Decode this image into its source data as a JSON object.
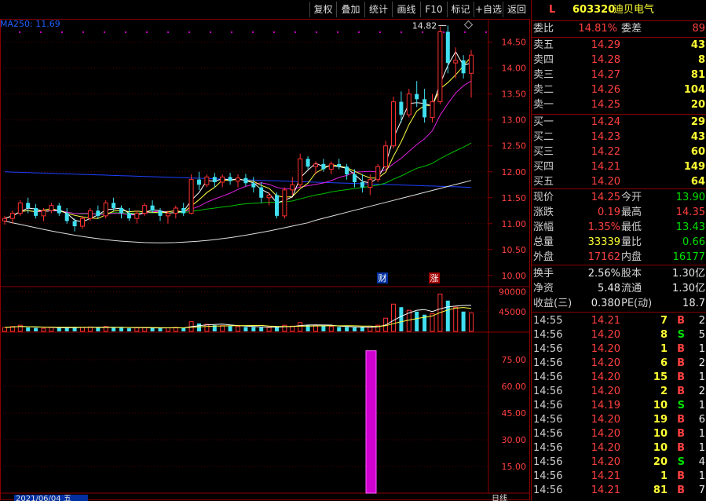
{
  "toolbar": {
    "buttons": [
      "复权",
      "叠加",
      "统计",
      "画线",
      "F10",
      "标记",
      "+自选",
      "返回"
    ]
  },
  "chart": {
    "ma_label": "MA250: 11.69",
    "high_marker": "14.82",
    "price_ticks": [
      "14.50",
      "14.00",
      "13.50",
      "13.00",
      "12.50",
      "12.00",
      "11.50",
      "11.00",
      "10.50",
      "10.00"
    ],
    "volume_ticks": [
      "90000",
      "45000"
    ],
    "indicator_ticks": [
      "75.00",
      "60.00",
      "45.00",
      "30.00",
      "15.00"
    ],
    "tag_cai": "财",
    "tag_zhang": "涨",
    "date_label": "2021/06/04 五",
    "corner_label": "日线"
  },
  "quote": {
    "market": "L",
    "code": "603320",
    "name": "迪贝电气",
    "weibi_label": "委比",
    "weibi": "14.81%",
    "weicha_label": "委差",
    "weicha": "89",
    "asks": [
      {
        "label": "卖五",
        "price": "14.29",
        "vol": "43"
      },
      {
        "label": "卖四",
        "price": "14.28",
        "vol": "8"
      },
      {
        "label": "卖三",
        "price": "14.27",
        "vol": "81"
      },
      {
        "label": "卖二",
        "price": "14.26",
        "vol": "104"
      },
      {
        "label": "卖一",
        "price": "14.25",
        "vol": "20"
      }
    ],
    "bids": [
      {
        "label": "买一",
        "price": "14.24",
        "vol": "29"
      },
      {
        "label": "买二",
        "price": "14.23",
        "vol": "43"
      },
      {
        "label": "买三",
        "price": "14.22",
        "vol": "60"
      },
      {
        "label": "买四",
        "price": "14.21",
        "vol": "149"
      },
      {
        "label": "买五",
        "price": "14.20",
        "vol": "64"
      }
    ],
    "stats": [
      {
        "l1": "现价",
        "v1": "14.25",
        "c1": "red",
        "l2": "今开",
        "v2": "13.90",
        "c2": "green"
      },
      {
        "l1": "涨跌",
        "v1": "0.19",
        "c1": "red",
        "l2": "最高",
        "v2": "14.35",
        "c2": "red"
      },
      {
        "l1": "涨幅",
        "v1": "1.35%",
        "c1": "red",
        "l2": "最低",
        "v2": "13.43",
        "c2": "green"
      },
      {
        "l1": "总量",
        "v1": "33339",
        "c1": "yellow",
        "l2": "量比",
        "v2": "0.66",
        "c2": "green"
      },
      {
        "l1": "外盘",
        "v1": "17162",
        "c1": "red",
        "l2": "内盘",
        "v2": "16177",
        "c2": "green"
      }
    ],
    "stats2": [
      {
        "l1": "换手",
        "v1": "2.56%",
        "l2": "股本",
        "v2": "1.30亿"
      },
      {
        "l1": "净资",
        "v1": "5.48",
        "l2": "流通",
        "v2": "1.30亿"
      },
      {
        "l1": "收益(三)",
        "v1": "0.380",
        "l2": "PE(动)",
        "v2": "18.7"
      }
    ],
    "ticks": [
      {
        "time": "14:55",
        "price": "14.21",
        "vol": "7",
        "side": "B",
        "n": "2"
      },
      {
        "time": "14:56",
        "price": "14.20",
        "vol": "8",
        "side": "S",
        "n": "5"
      },
      {
        "time": "14:56",
        "price": "14.20",
        "vol": "1",
        "side": "B",
        "n": "1"
      },
      {
        "time": "14:56",
        "price": "14.20",
        "vol": "6",
        "side": "B",
        "n": "2"
      },
      {
        "time": "14:56",
        "price": "14.20",
        "vol": "15",
        "side": "B",
        "n": "1"
      },
      {
        "time": "14:56",
        "price": "14.20",
        "vol": "2",
        "side": "B",
        "n": "2"
      },
      {
        "time": "14:56",
        "price": "14.19",
        "vol": "10",
        "side": "S",
        "n": "1"
      },
      {
        "time": "14:56",
        "price": "14.20",
        "vol": "19",
        "side": "B",
        "n": "6"
      },
      {
        "time": "14:56",
        "price": "14.20",
        "vol": "10",
        "side": "B",
        "n": "1"
      },
      {
        "time": "14:56",
        "price": "14.20",
        "vol": "10",
        "side": "B",
        "n": "1"
      },
      {
        "time": "14:56",
        "price": "14.20",
        "vol": "20",
        "side": "S",
        "n": "4"
      },
      {
        "time": "14:56",
        "price": "14.21",
        "vol": "1",
        "side": "B",
        "n": "1"
      },
      {
        "time": "14:56",
        "price": "14.21",
        "vol": "81",
        "side": "B",
        "n": "7"
      }
    ]
  },
  "chart_data": {
    "type": "candlestick",
    "price_range": [
      9.8,
      14.95
    ],
    "volume_range": [
      0,
      100000
    ],
    "indicator_range": [
      0,
      90
    ],
    "candles": [
      [
        11.05,
        11.15,
        10.98,
        11.1
      ],
      [
        11.1,
        11.25,
        11.0,
        11.2
      ],
      [
        11.2,
        11.45,
        11.15,
        11.4
      ],
      [
        11.4,
        11.5,
        11.2,
        11.3
      ],
      [
        11.3,
        11.38,
        11.1,
        11.15
      ],
      [
        11.15,
        11.3,
        11.05,
        11.25
      ],
      [
        11.25,
        11.4,
        11.2,
        11.35
      ],
      [
        11.35,
        11.4,
        11.15,
        11.2
      ],
      [
        11.2,
        11.3,
        11.0,
        11.05
      ],
      [
        11.05,
        11.1,
        10.85,
        10.95
      ],
      [
        10.95,
        11.15,
        10.9,
        11.1
      ],
      [
        11.1,
        11.3,
        11.05,
        11.25
      ],
      [
        11.25,
        11.35,
        11.1,
        11.15
      ],
      [
        11.15,
        11.45,
        11.1,
        11.4
      ],
      [
        11.4,
        11.5,
        11.25,
        11.3
      ],
      [
        11.3,
        11.35,
        11.1,
        11.2
      ],
      [
        11.2,
        11.3,
        11.05,
        11.1
      ],
      [
        11.1,
        11.25,
        11.0,
        11.2
      ],
      [
        11.2,
        11.4,
        11.15,
        11.35
      ],
      [
        11.35,
        11.45,
        11.2,
        11.25
      ],
      [
        11.25,
        11.3,
        11.05,
        11.15
      ],
      [
        11.15,
        11.25,
        11.0,
        11.2
      ],
      [
        11.2,
        11.35,
        11.1,
        11.3
      ],
      [
        11.3,
        11.4,
        11.15,
        11.2
      ],
      [
        11.2,
        11.95,
        11.18,
        11.85
      ],
      [
        11.85,
        12.0,
        11.65,
        11.75
      ],
      [
        11.75,
        11.95,
        11.7,
        11.9
      ],
      [
        11.9,
        11.98,
        11.7,
        11.8
      ],
      [
        11.8,
        11.95,
        11.7,
        11.9
      ],
      [
        11.9,
        11.98,
        11.75,
        11.82
      ],
      [
        11.82,
        11.95,
        11.7,
        11.88
      ],
      [
        11.88,
        11.96,
        11.72,
        11.78
      ],
      [
        11.78,
        11.9,
        11.6,
        11.7
      ],
      [
        11.7,
        11.8,
        11.4,
        11.5
      ],
      [
        11.5,
        11.6,
        11.35,
        11.55
      ],
      [
        11.55,
        11.6,
        11.1,
        11.15
      ],
      [
        11.15,
        11.7,
        11.1,
        11.65
      ],
      [
        11.65,
        11.9,
        11.55,
        11.75
      ],
      [
        11.75,
        12.35,
        11.7,
        12.25
      ],
      [
        12.25,
        12.3,
        12.05,
        12.1
      ],
      [
        12.1,
        12.2,
        11.95,
        12.15
      ],
      [
        12.15,
        12.25,
        12.0,
        12.05
      ],
      [
        12.05,
        12.2,
        11.95,
        12.15
      ],
      [
        12.15,
        12.25,
        12.05,
        12.1
      ],
      [
        12.1,
        12.15,
        11.85,
        11.95
      ],
      [
        11.95,
        12.05,
        11.7,
        11.8
      ],
      [
        11.8,
        11.95,
        11.6,
        11.7
      ],
      [
        11.7,
        11.95,
        11.55,
        11.85
      ],
      [
        11.85,
        12.15,
        11.8,
        12.1
      ],
      [
        12.1,
        12.6,
        12.05,
        12.5
      ],
      [
        12.5,
        13.45,
        12.45,
        13.35
      ],
      [
        13.35,
        13.55,
        12.95,
        13.1
      ],
      [
        13.1,
        13.6,
        13.05,
        13.5
      ],
      [
        13.5,
        13.75,
        13.25,
        13.4
      ],
      [
        13.4,
        13.6,
        12.95,
        13.05
      ],
      [
        13.05,
        13.5,
        12.95,
        13.35
      ],
      [
        13.35,
        14.8,
        13.3,
        14.7
      ],
      [
        14.7,
        14.82,
        13.9,
        14.1
      ],
      [
        14.1,
        14.4,
        13.8,
        14.15
      ],
      [
        14.15,
        14.25,
        13.8,
        13.9
      ],
      [
        13.9,
        14.35,
        13.43,
        14.25
      ]
    ],
    "volumes": [
      9000,
      11000,
      14000,
      9000,
      8000,
      7000,
      9000,
      8000,
      9000,
      10000,
      9000,
      10000,
      8000,
      11000,
      9000,
      8000,
      7000,
      8000,
      9000,
      8000,
      7000,
      8000,
      9000,
      8000,
      22000,
      18000,
      16000,
      14000,
      13000,
      12000,
      11000,
      10000,
      10000,
      9000,
      9000,
      11000,
      14000,
      12000,
      20000,
      15000,
      13000,
      12000,
      11000,
      10000,
      10000,
      9000,
      9000,
      10000,
      14000,
      30000,
      62000,
      55000,
      48000,
      45000,
      38000,
      40000,
      85000,
      70000,
      55000,
      45000,
      42000
    ],
    "indicator_bar": {
      "index": 45,
      "value": 80
    }
  }
}
